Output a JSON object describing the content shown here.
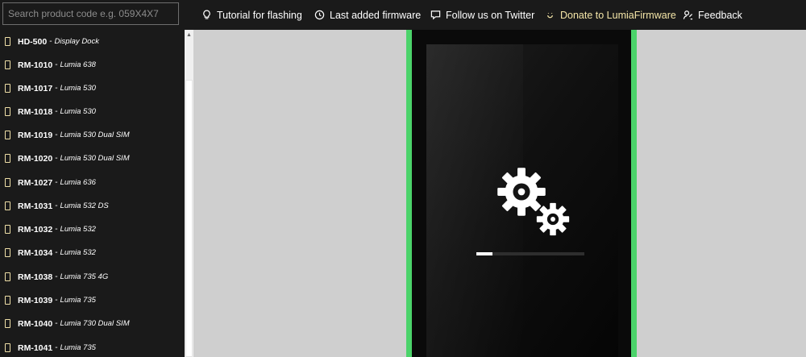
{
  "search": {
    "placeholder": "Search product code e.g. 059X4X7"
  },
  "nav": [
    {
      "label": "Tutorial for flashing",
      "icon": "lightbulb-icon"
    },
    {
      "label": "Last added firmware",
      "icon": "history-icon"
    },
    {
      "label": "Follow us on Twitter",
      "icon": "chat-icon"
    },
    {
      "label": "Donate to LumiaFirmware",
      "icon": "smile-icon"
    },
    {
      "label": "Feedback",
      "icon": "feedback-icon"
    }
  ],
  "colors": {
    "accent_green": "#4bd36a",
    "donate": "#f5e6a8",
    "bar": "#1a1a1a"
  },
  "sidebar": {
    "separator": "-",
    "items": [
      {
        "code": "HD-500",
        "model": "Display Dock"
      },
      {
        "code": "RM-1010",
        "model": "Lumia 638"
      },
      {
        "code": "RM-1017",
        "model": "Lumia 530"
      },
      {
        "code": "RM-1018",
        "model": "Lumia 530"
      },
      {
        "code": "RM-1019",
        "model": "Lumia 530 Dual SIM"
      },
      {
        "code": "RM-1020",
        "model": "Lumia 530 Dual SIM"
      },
      {
        "code": "RM-1027",
        "model": "Lumia 636"
      },
      {
        "code": "RM-1031",
        "model": "Lumia 532 DS"
      },
      {
        "code": "RM-1032",
        "model": "Lumia 532"
      },
      {
        "code": "RM-1034",
        "model": "Lumia 532"
      },
      {
        "code": "RM-1038",
        "model": "Lumia 735 4G"
      },
      {
        "code": "RM-1039",
        "model": "Lumia 735"
      },
      {
        "code": "RM-1040",
        "model": "Lumia 730 Dual SIM"
      },
      {
        "code": "RM-1041",
        "model": "Lumia 735"
      }
    ]
  },
  "flashing": {
    "progress_fraction": 0.15
  }
}
